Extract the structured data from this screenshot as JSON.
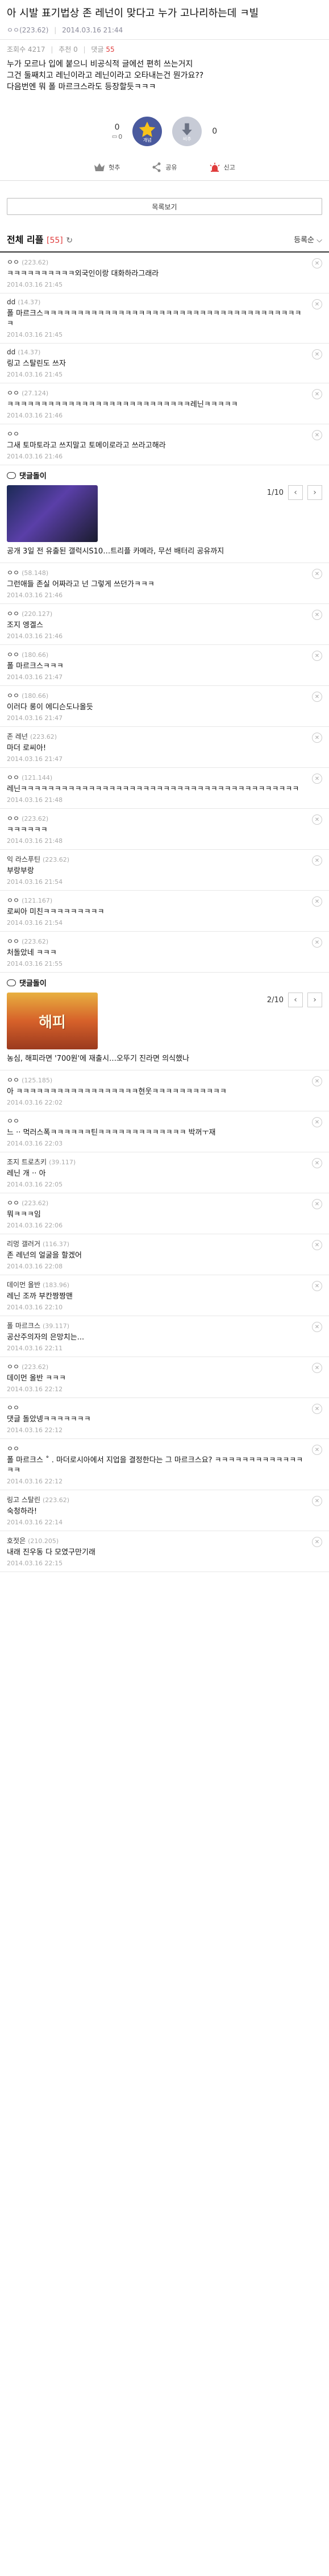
{
  "post": {
    "title": "아 시발 표기법상 존 레넌이 맞다고 누가 고나리하는데 ㅋ빌",
    "author": "ㅇㅇ(223.62)",
    "date": "2014.03.16 21:44",
    "views": "조회수 4217",
    "recommends": "추천 0",
    "replies_label": "댓글",
    "replies_count": "55",
    "body": [
      "누가 모르나 입에 붙으니 비공식적 글에선 편히 쓰는거지",
      "그건 둘째치고 레닌이라고 레닌이라고 오타내는건 뭔가요??",
      "다음번엔 뭐 폴 마르크스라도 등장할듯ㅋㅋㅋ"
    ]
  },
  "votes": {
    "up_count": "0",
    "up_sub": "0",
    "up_label": "개념",
    "down_count": "0",
    "down_label": "비추"
  },
  "actions": {
    "fix": "헛추",
    "share": "공유",
    "report": "신고"
  },
  "list_button": "목록보기",
  "reply_section": {
    "title": "전체 리플",
    "count": "[55]",
    "sort": "등록순"
  },
  "comments": [
    {
      "name": "ㅇㅇ",
      "ip": "(223.62)",
      "text": "ㅋㅋㅋㅋㅋㅋㅋㅋㅋㅋ외국인이랑 대화하라그래라",
      "date": "2014.03.16 21:45"
    },
    {
      "name": "dd",
      "ip": "(14.37)",
      "text": "폴 마르크스ㅋㅋㅋㅋㅋㅋㅋㅋㅋㅋㅋㅋㅋㅋㅋㅋㅋㅋㅋㅋㅋㅋㅋㅋㅋㅋㅋㅋㅋㅋㅋㅋㅋㅋㅋㅋㅋㅋㅋ",
      "date": "2014.03.16 21:45"
    },
    {
      "name": "dd",
      "ip": "(14.37)",
      "text": "링고 스탈린도 쓰자",
      "date": "2014.03.16 21:45"
    },
    {
      "name": "ㅇㅇ",
      "ip": "(27.124)",
      "text": "ㅋㅋㅋㅋㅋㅋㅋㅋㅋㅋㅋㅋㅋㅋㅋㅋㅋㅋㅋㅋㅋㅋㅋㅋㅋㅋㅋ레닌ㅋㅋㅋㅋㅋ",
      "date": "2014.03.16 21:46"
    },
    {
      "name": "ㅇㅇ",
      "ip": "",
      "text": "그새 토마토라고 쓰지말고 토메이로라고 쓰라고해라",
      "date": "2014.03.16 21:46"
    }
  ],
  "dc_card_1": {
    "label": "댓글돌이",
    "page": "1/10",
    "caption": "공개 3일 전 유출된 갤럭시S10…트리플 카메라, 무선 배터리 공유까지"
  },
  "comments_2": [
    {
      "name": "ㅇㅇ",
      "ip": "(58.148)",
      "text": "그런애들 존실 어짜라고 넌 그렇게 쓰던가ㅋㅋㅋ",
      "date": "2014.03.16 21:46"
    },
    {
      "name": "ㅇㅇ",
      "ip": "(220.127)",
      "text": "조지 엥겔스",
      "date": "2014.03.16 21:46"
    },
    {
      "name": "ㅇㅇ",
      "ip": "(180.66)",
      "text": "폴 마르크스ㅋㅋㅋ",
      "date": "2014.03.16 21:47"
    },
    {
      "name": "ㅇㅇ",
      "ip": "(180.66)",
      "text": "이러다 롱이 에디슨도나올듯",
      "date": "2014.03.16 21:47"
    },
    {
      "name": "존 레넌",
      "ip": "(223.62)",
      "text": "마더 로씨아!",
      "date": "2014.03.16 21:47"
    },
    {
      "name": "ㅇㅇ",
      "ip": "(121.144)",
      "text": "레닌ㅋㅋㅋㅋㅋㅋㅋㅋㅋㅋㅋㅋㅋㅋㅋㅋㅋㅋㅋㅋㅋㅋㅋㅋㅋㅋㅋㅋㅋㅋㅋㅋㅋㅋㅋㅋㅋㅋㅋㅋㅋ",
      "date": "2014.03.16 21:48"
    },
    {
      "name": "ㅇㅇ",
      "ip": "(223.62)",
      "text": "ㅋㅋㅋㅋㅋㅋ",
      "date": "2014.03.16 21:48"
    },
    {
      "name": "익 라스푸틴",
      "ip": "(223.62)",
      "text": "부랑부랑",
      "date": "2014.03.16 21:54"
    },
    {
      "name": "ㅇㅇ",
      "ip": "(121.167)",
      "text": "로씨아 미친ㅋㅋㅋㅋㅋㅋㅋㅋㅋ",
      "date": "2014.03.16 21:54"
    },
    {
      "name": "ㅇㅇ",
      "ip": "(223.62)",
      "text": "처돌았네 ㅋㅋㅋ",
      "date": "2014.03.16 21:55"
    }
  ],
  "dc_card_2": {
    "label": "댓글돌이",
    "page": "2/10",
    "thumb_text": "해피",
    "caption": "농심, 해피라면 '700원'에 재출시…오뚜기 진라면 의식했나"
  },
  "comments_3": [
    {
      "name": "ㅇㅇ",
      "ip": "(125.185)",
      "text": "아 ㅋㅋㅋㅋㅋㅋㅋㅋㅋㅋㅋㅋㅋㅋㅋㅋㅋㅋ현웃ㅋㅋㅋㅋㅋㅋㅋㅋㅋㅋㅋ",
      "date": "2014.03.16 22:02"
    },
    {
      "name": "ㅇㅇ",
      "ip": "",
      "text": "느 ·· 먹러스폭ㅋㅋㅋㅋㅋㅋ틴ㅋㅋㅋㅋㅋㅋㅋㅋㅋㅋㅋㅋㅋ 박꺼ㅜ재",
      "date": "2014.03.16 22:03"
    },
    {
      "name": "조지 트로츠키",
      "ip": "(39.117)",
      "text": "레닌 개 ·· 아",
      "date": "2014.03.16 22:05"
    },
    {
      "name": "ㅇㅇ",
      "ip": "(223.62)",
      "text": "뭐ㅋㅋㅋ임",
      "date": "2014.03.16 22:06"
    },
    {
      "name": "리멍 갤러거",
      "ip": "(116.37)",
      "text": "존 레넌의 얼굴을 할겠어",
      "date": "2014.03.16 22:08"
    },
    {
      "name": "데이먼 올반",
      "ip": "(183.96)",
      "text": "레닌 조까 부칸짱짱맨",
      "date": "2014.03.16 22:10"
    },
    {
      "name": "폴 마르크스",
      "ip": "(39.117)",
      "text": "공산주의자의 은망치는...",
      "date": "2014.03.16 22:11"
    },
    {
      "name": "ㅇㅇ",
      "ip": "(223.62)",
      "text": "데이먼 올반 ㅋㅋㅋ",
      "date": "2014.03.16 22:12"
    },
    {
      "name": "ㅇㅇ",
      "ip": "",
      "text": "댓글 돌았넹ㅋㅋㅋㅋㅋㅋㅋ",
      "date": "2014.03.16 22:12"
    },
    {
      "name": "ㅇㅇ",
      "ip": "",
      "text": "폴 마르크스 ˚ . 마더로시아에서 지업을 결정한다는 그 마르크스요? ㅋㅋㅋㅋㅋㅋㅋㅋㅋㅋㅋㅋㅋㅋㅋ",
      "date": "2014.03.16 22:12"
    },
    {
      "name": "링고 스탈린",
      "ip": "(223.62)",
      "text": "숙청하라!",
      "date": "2014.03.16 22:14"
    },
    {
      "name": "호젓은",
      "ip": "(210.205)",
      "text": "내래 진우동 다 모였구만기래",
      "date": "2014.03.16 22:15"
    }
  ]
}
